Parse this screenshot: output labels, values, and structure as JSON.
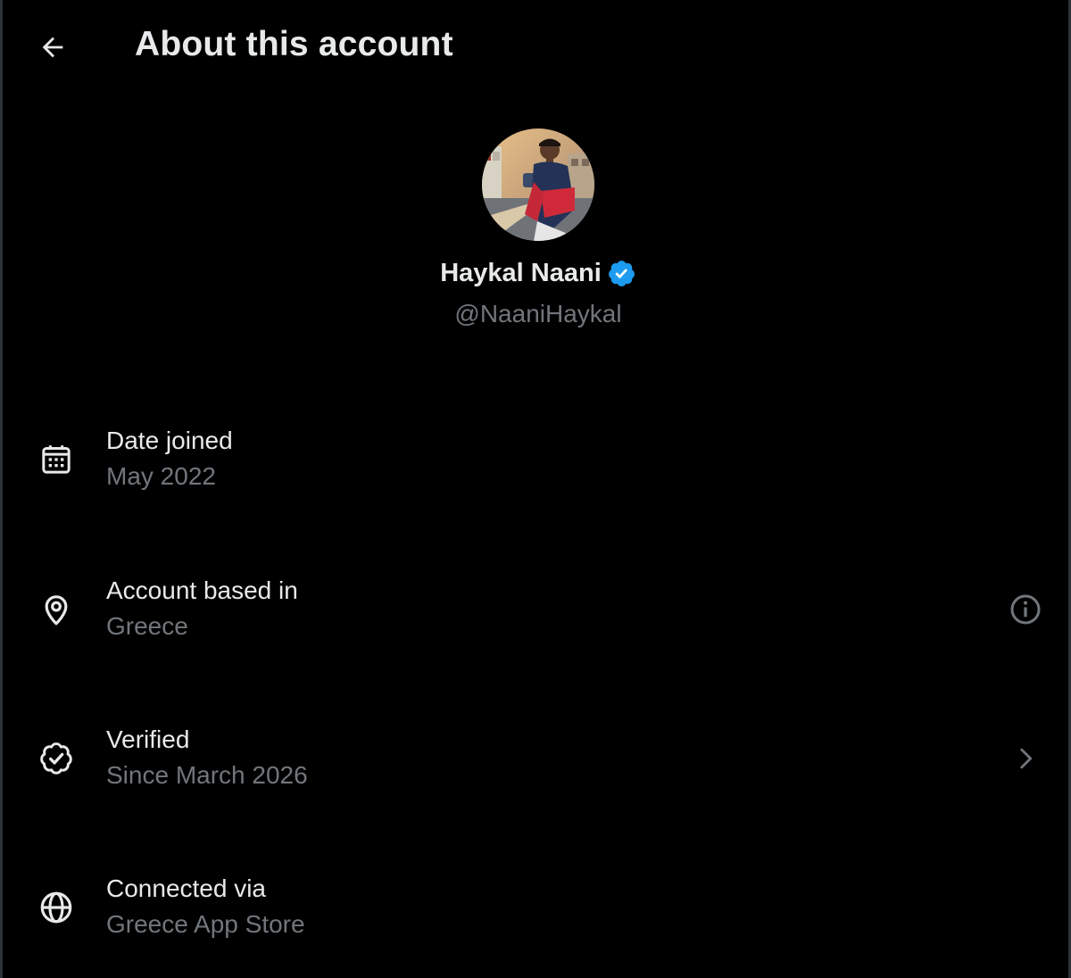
{
  "header": {
    "title": "About this account",
    "back_icon": "arrow-left-icon"
  },
  "profile": {
    "name": "Haykal Naani",
    "handle": "@NaaniHaykal",
    "verified_badge_color": "#1d9bf0"
  },
  "rows": [
    {
      "icon": "calendar-icon",
      "label": "Date joined",
      "value": "May 2022"
    },
    {
      "icon": "location-pin-icon",
      "label": "Account based in",
      "value": "Greece",
      "action_icon": "info-icon"
    },
    {
      "icon": "verified-badge-icon",
      "label": "Verified",
      "value": "Since March 2026",
      "action_icon": "chevron-right-icon"
    },
    {
      "icon": "globe-icon",
      "label": "Connected via",
      "value": "Greece App Store"
    }
  ],
  "colors": {
    "background": "#000000",
    "primary_text": "#e7e9ea",
    "secondary_text": "#71767b",
    "accent": "#1d9bf0"
  }
}
